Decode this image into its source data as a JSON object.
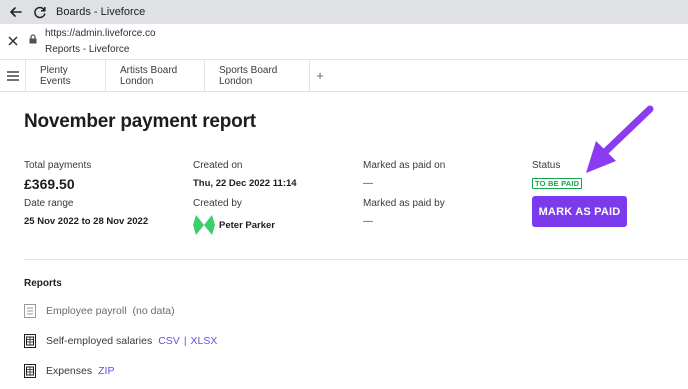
{
  "window": {
    "title": "Boards - Liveforce",
    "url": "https://admin.liveforce.co",
    "page_subtitle": "Reports - Liveforce"
  },
  "tabs": [
    {
      "label": "Plenty Events"
    },
    {
      "label": "Artists Board London"
    },
    {
      "label": "Sports Board London"
    }
  ],
  "tabs_add_label": "+",
  "report": {
    "title": "November payment report",
    "total_payments_label": "Total payments",
    "total_payments_value": "£369.50",
    "date_range_label": "Date range",
    "date_range_value": "25 Nov 2022 to 28 Nov 2022",
    "created_on_label": "Created on",
    "created_on_value": "Thu, 22 Dec 2022 11:14",
    "created_by_label": "Created by",
    "created_by_value": "Peter Parker",
    "marked_paid_on_label": "Marked as paid on",
    "marked_paid_on_value": "—",
    "marked_paid_by_label": "Marked as paid by",
    "marked_paid_by_value": "—",
    "status_label": "Status",
    "status_value": "TO BE PAID",
    "mark_button_label": "MARK AS PAID"
  },
  "reports_section": {
    "title": "Reports",
    "items": [
      {
        "name": "Employee payroll",
        "note": "(no data)"
      },
      {
        "name": "Self-employed salaries",
        "links": [
          "CSV",
          "XLSX"
        ],
        "separator": "|"
      },
      {
        "name": "Expenses",
        "links": [
          "ZIP"
        ]
      }
    ]
  },
  "colors": {
    "accent": "#7c3aed",
    "link": "#6d49e7",
    "status_green": "#15a64a",
    "annotation_arrow": "#8b3bf0"
  },
  "icons": [
    "back-arrow-icon",
    "reload-icon",
    "close-icon",
    "lock-icon",
    "hamburger-menu-icon",
    "document-icon",
    "annotation-arrow"
  ]
}
